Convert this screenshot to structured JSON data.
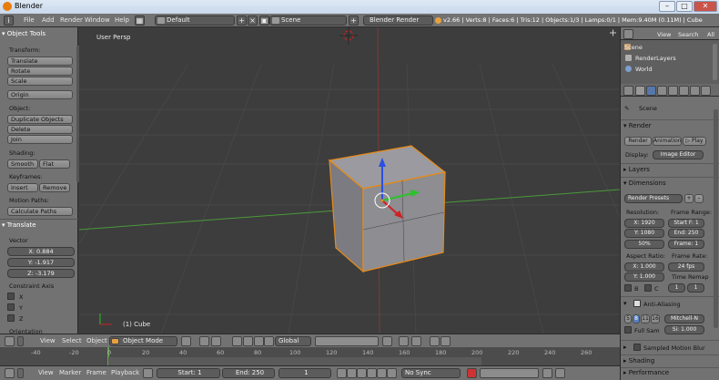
{
  "window": {
    "title": "Blender"
  },
  "info_header": {
    "menus": [
      "File",
      "Add",
      "Render",
      "Window",
      "Help"
    ],
    "layout": "Default",
    "scene": "Scene",
    "engine": "Blender Render",
    "stats": "v2.66 | Verts:8 | Faces:6 | Tris:12 | Objects:1/3 | Lamps:0/1 | Mem:9.40M (0.11M) | Cube"
  },
  "tool_panel": {
    "object_tools_title": "Object Tools",
    "transform_label": "Transform:",
    "translate": "Translate",
    "rotate": "Rotate",
    "scale": "Scale",
    "origin": "Origin",
    "object_label": "Object:",
    "duplicate_objects": "Duplicate Objects",
    "delete": "Delete",
    "join": "Join",
    "shading_label": "Shading:",
    "smooth": "Smooth",
    "flat": "Flat",
    "keyframes_label": "Keyframes:",
    "insert": "Insert",
    "remove": "Remove",
    "motion_paths_label": "Motion Paths:",
    "calculate_paths": "Calculate Paths",
    "translate_op_title": "Translate",
    "vector_label": "Vector",
    "x_field": "X: 0.884",
    "y_field": "Y: -1.917",
    "z_field": "Z: -3.179",
    "constraint_axis_label": "Constraint Axis",
    "axis_x": "X",
    "axis_y": "Y",
    "axis_z": "Z",
    "orientation_label": "Orientation"
  },
  "viewport": {
    "view_label": "User Persp",
    "object_label": "(1) Cube"
  },
  "view3d_header": {
    "view": "View",
    "select": "Select",
    "object": "Object",
    "mode": "Object Mode",
    "orientation": "Global"
  },
  "timeline": {
    "ticks": [
      "-40",
      "-20",
      "0",
      "20",
      "40",
      "60",
      "80",
      "100",
      "120",
      "140",
      "160",
      "180",
      "200",
      "220",
      "240",
      "260"
    ],
    "view": "View",
    "marker": "Marker",
    "frame": "Frame",
    "playback": "Playback",
    "start": "Start: 1",
    "end": "End: 250",
    "current": "1",
    "sync": "No Sync"
  },
  "outliner": {
    "view": "View",
    "search": "Search",
    "all": "All",
    "items": [
      "Scene",
      "RenderLayers",
      "World"
    ]
  },
  "properties": {
    "context": "Scene",
    "render_title": "Render",
    "render_btn": "Render",
    "animation_btn": "Animation",
    "play_btn": "Play",
    "display_label": "Display:",
    "display_value": "Image Editor",
    "layers_title": "Layers",
    "dimensions_title": "Dimensions",
    "render_presets": "Render Presets",
    "resolution_label": "Resolution:",
    "frame_range_label": "Frame Range:",
    "res_x": "X: 1920",
    "res_y": "Y: 1080",
    "res_pct": "50%",
    "start_frame": "Start F: 1",
    "end_frame": "End: 250",
    "frame_step": "Frame: 1",
    "aspect_label": "Aspect Ratio:",
    "frame_rate_label": "Frame Rate:",
    "aspect_x": "X: 1.000",
    "aspect_y": "Y: 1.000",
    "fps": "24 fps",
    "time_remap_label": "Time Remap",
    "b_label": "B",
    "c_label": "C",
    "remap_old": "1",
    "remap_new": "1",
    "aa_title": "Anti-Aliasing",
    "aa_samples": [
      "5",
      "8",
      "11",
      "16"
    ],
    "aa_filter": "Mitchell-N",
    "full_sample": "Full Sam",
    "aa_size": "Si: 1.000",
    "motion_blur_title": "Sampled Motion Blur",
    "shading_title": "Shading",
    "performance_title": "Performance"
  },
  "colors": {
    "selection_outline": "#e88a17",
    "x_axis": "#c03a3a",
    "y_axis": "#4a9a3a",
    "gizmo_z": "#2c4fe0",
    "gizmo_y": "#28c428",
    "gizmo_x": "#d02020"
  }
}
